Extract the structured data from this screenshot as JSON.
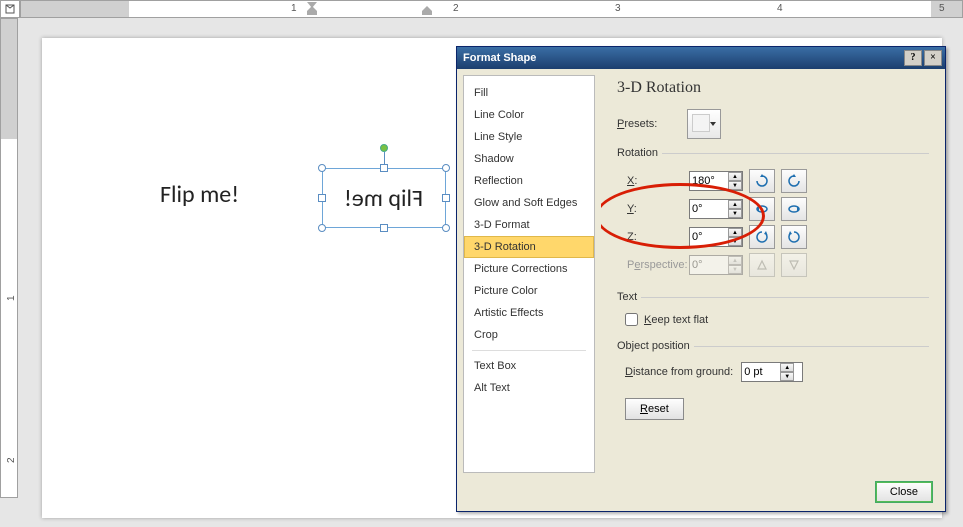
{
  "ruler": {
    "h_numbers": [
      "1",
      "2",
      "3",
      "4",
      "5"
    ],
    "v_numbers": [
      "1",
      "2"
    ]
  },
  "doc": {
    "text_left": "Flip me!",
    "text_box": "Flip me!"
  },
  "dialog": {
    "title": "Format Shape",
    "nav": [
      "Fill",
      "Line Color",
      "Line Style",
      "Shadow",
      "Reflection",
      "Glow and Soft Edges",
      "3-D Format",
      "3-D Rotation",
      "Picture Corrections",
      "Picture Color",
      "Artistic Effects",
      "Crop",
      "Text Box",
      "Alt Text"
    ],
    "nav_selected_index": 7,
    "heading": "3-D Rotation",
    "presets_label": "Presets:",
    "rotation_legend": "Rotation",
    "axes": {
      "x": {
        "label": "X:",
        "value": "180°"
      },
      "y": {
        "label": "Y:",
        "value": "0°"
      },
      "z": {
        "label": "Z:",
        "value": "0°"
      },
      "perspective": {
        "label": "Perspective:",
        "value": "0°"
      }
    },
    "text_legend": "Text",
    "keep_flat_label": "Keep text flat",
    "keep_flat_checked": false,
    "object_pos_legend": "Object position",
    "distance_label": "Distance from ground:",
    "distance_value": "0 pt",
    "reset_label": "Reset",
    "close_label": "Close"
  }
}
